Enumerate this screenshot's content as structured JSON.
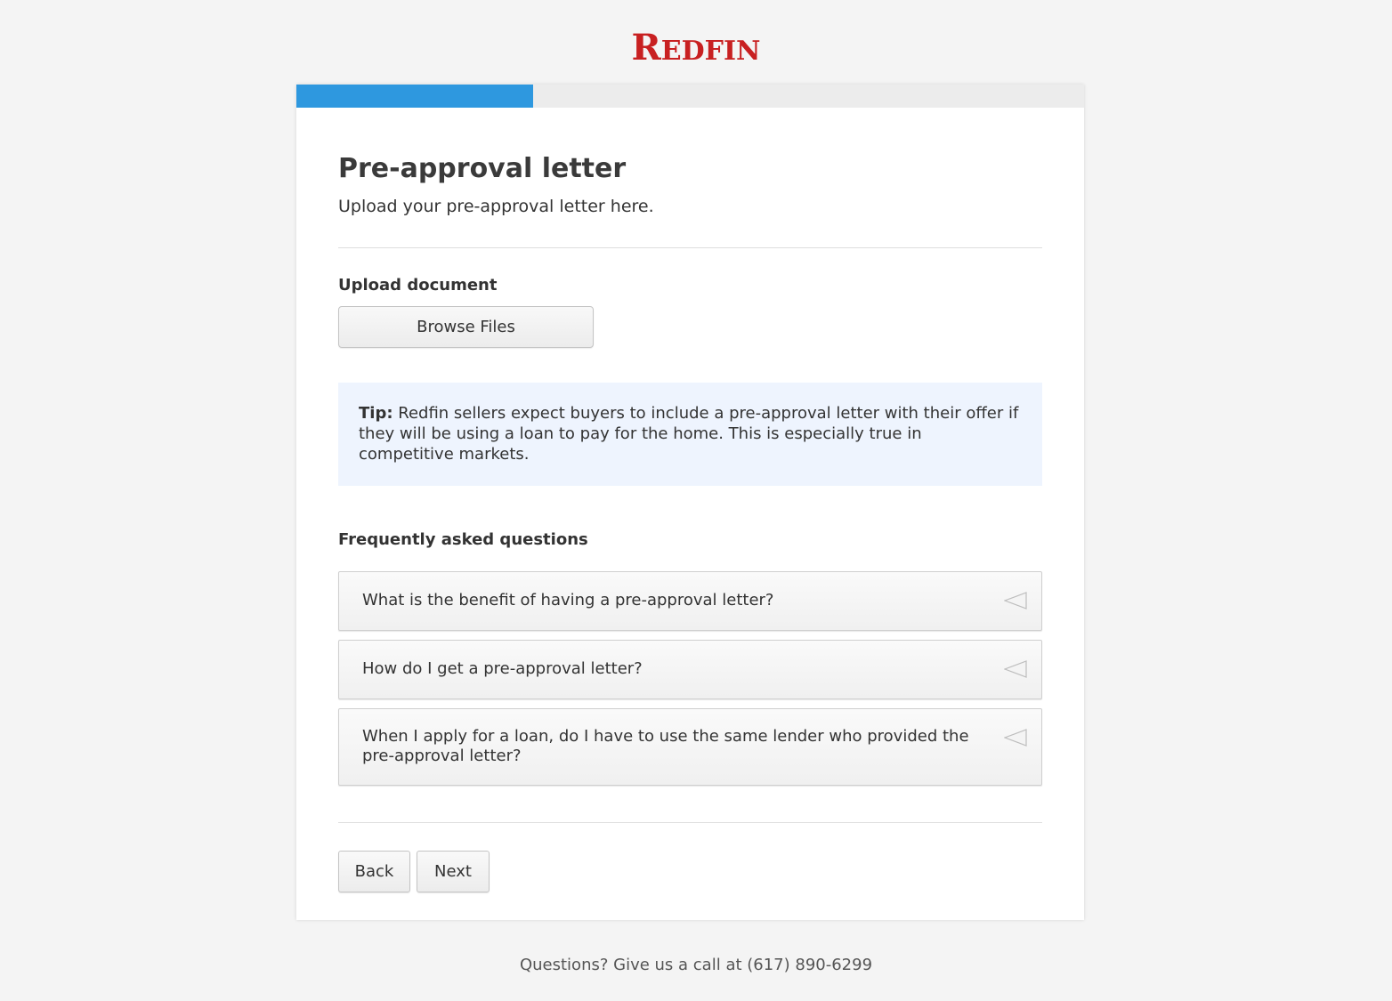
{
  "brand": {
    "name_first": "R",
    "name_rest": "EDFIN",
    "color": "#c82021"
  },
  "progress": {
    "fraction": 0.3,
    "color": "#2e98df"
  },
  "page": {
    "title": "Pre-approval letter",
    "subtitle": "Upload your pre-approval letter here."
  },
  "upload": {
    "label": "Upload document",
    "button_label": "Browse Files"
  },
  "tip": {
    "label": "Tip:",
    "text": " Redfin sellers expect buyers to include a pre-approval letter with their offer if they will be using a loan to pay for the home. This is especially true in competitive markets."
  },
  "faq": {
    "heading": "Frequently asked questions",
    "items": [
      {
        "question": "What is the benefit of having a pre-approval letter?"
      },
      {
        "question": "How do I get a pre-approval letter?"
      },
      {
        "question": "When I apply for a loan, do I have to use the same lender who provided the pre-approval letter?"
      }
    ]
  },
  "nav": {
    "back_label": "Back",
    "next_label": "Next"
  },
  "footer": {
    "text": "Questions? Give us a call at (617) 890-6299"
  }
}
